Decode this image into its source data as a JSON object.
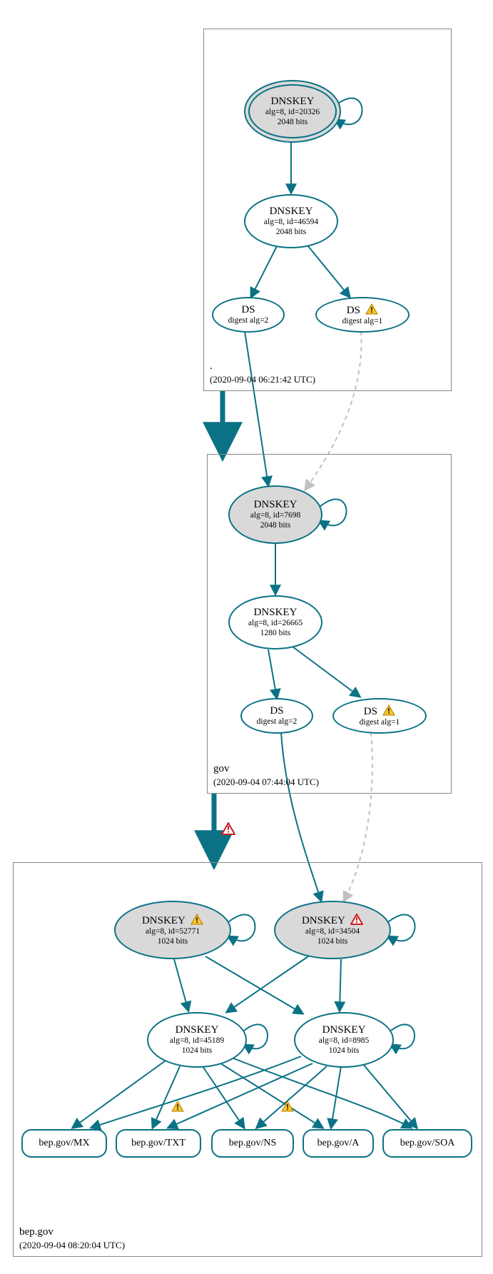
{
  "zones": {
    "root": {
      "name": ".",
      "time": "(2020-09-04 06:21:42 UTC)"
    },
    "gov": {
      "name": "gov",
      "time": "(2020-09-04 07:44:04 UTC)"
    },
    "bep": {
      "name": "bep.gov",
      "time": "(2020-09-04 08:20:04 UTC)"
    }
  },
  "nodes": {
    "root_ksk": {
      "title": "DNSKEY",
      "l1": "alg=8, id=20326",
      "l2": "2048 bits"
    },
    "root_zsk": {
      "title": "DNSKEY",
      "l1": "alg=8, id=46594",
      "l2": "2048 bits"
    },
    "root_ds2": {
      "title": "DS",
      "l1": "digest alg=2"
    },
    "root_ds1": {
      "title": "DS",
      "l1": "digest alg=1"
    },
    "gov_ksk": {
      "title": "DNSKEY",
      "l1": "alg=8, id=7698",
      "l2": "2048 bits"
    },
    "gov_zsk": {
      "title": "DNSKEY",
      "l1": "alg=8, id=26665",
      "l2": "1280 bits"
    },
    "gov_ds2": {
      "title": "DS",
      "l1": "digest alg=2"
    },
    "gov_ds1": {
      "title": "DS",
      "l1": "digest alg=1"
    },
    "bep_ksk1": {
      "title": "DNSKEY",
      "l1": "alg=8, id=52771",
      "l2": "1024 bits"
    },
    "bep_ksk2": {
      "title": "DNSKEY",
      "l1": "alg=8, id=34504",
      "l2": "1024 bits"
    },
    "bep_zsk1": {
      "title": "DNSKEY",
      "l1": "alg=8, id=45189",
      "l2": "1024 bits"
    },
    "bep_zsk2": {
      "title": "DNSKEY",
      "l1": "alg=8, id=8985",
      "l2": "1024 bits"
    }
  },
  "rr": {
    "mx": "bep.gov/MX",
    "txt": "bep.gov/TXT",
    "ns": "bep.gov/NS",
    "a": "bep.gov/A",
    "soa": "bep.gov/SOA"
  }
}
